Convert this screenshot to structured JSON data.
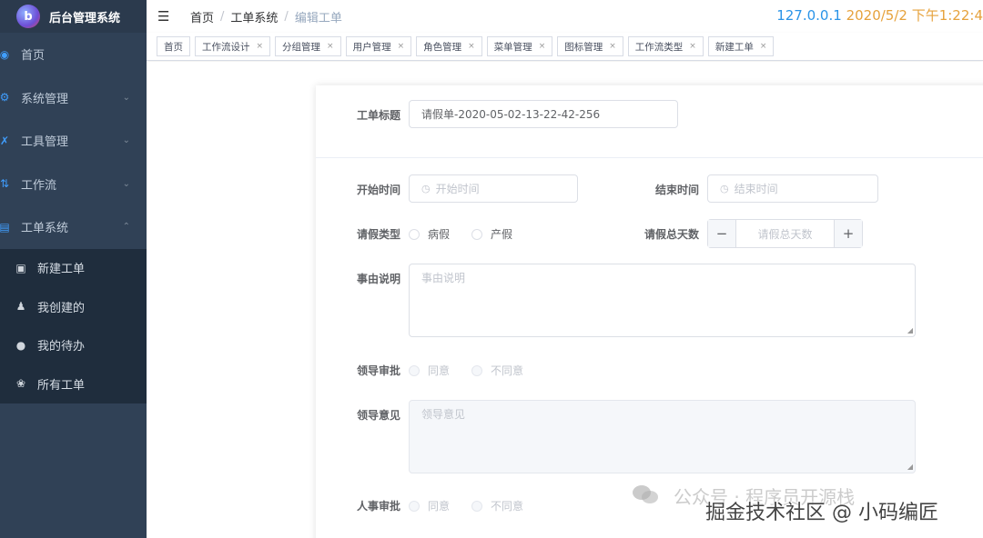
{
  "brand": {
    "logo_letter": "b",
    "title": "后台管理系统"
  },
  "sidebar": {
    "items": [
      {
        "label": "首页",
        "icon": "dashboard-icon"
      },
      {
        "label": "系统管理",
        "icon": "gear-icon"
      },
      {
        "label": "工具管理",
        "icon": "tools-icon"
      },
      {
        "label": "工作流",
        "icon": "workflow-icon"
      },
      {
        "label": "工单系统",
        "icon": "ticket-icon"
      }
    ],
    "subitems": [
      {
        "label": "新建工单",
        "icon": "new-ticket-icon"
      },
      {
        "label": "我创建的",
        "icon": "user-lock-icon"
      },
      {
        "label": "我的待办",
        "icon": "chat-bubble-icon"
      },
      {
        "label": "所有工单",
        "icon": "clover-icon"
      }
    ]
  },
  "header": {
    "breadcrumb": [
      "首页",
      "工单系统",
      "编辑工单"
    ],
    "ip": "127.0.0.1",
    "datetime": "2020/5/2 下午1:22:4"
  },
  "tags": [
    "首页",
    "工作流设计",
    "分组管理",
    "用户管理",
    "角色管理",
    "菜单管理",
    "图标管理",
    "工作流类型",
    "新建工单"
  ],
  "form": {
    "title_label": "工单标题",
    "title_value": "请假单-2020-05-02-13-22-42-256",
    "start_label": "开始时间",
    "start_placeholder": "开始时间",
    "end_label": "结束时间",
    "end_placeholder": "结束时间",
    "type_label": "请假类型",
    "type_options": [
      "病假",
      "产假"
    ],
    "days_label": "请假总天数",
    "days_placeholder": "请假总天数",
    "reason_label": "事由说明",
    "reason_placeholder": "事由说明",
    "leader_label": "领导审批",
    "approve_options": [
      "同意",
      "不同意"
    ],
    "leader_opinion_label": "领导意见",
    "leader_opinion_placeholder": "领导意见",
    "hr_label": "人事审批"
  },
  "watermark": {
    "account": "公众号 · 程序员开源栈",
    "site": "掘金技术社区 @ 小码编匠"
  }
}
